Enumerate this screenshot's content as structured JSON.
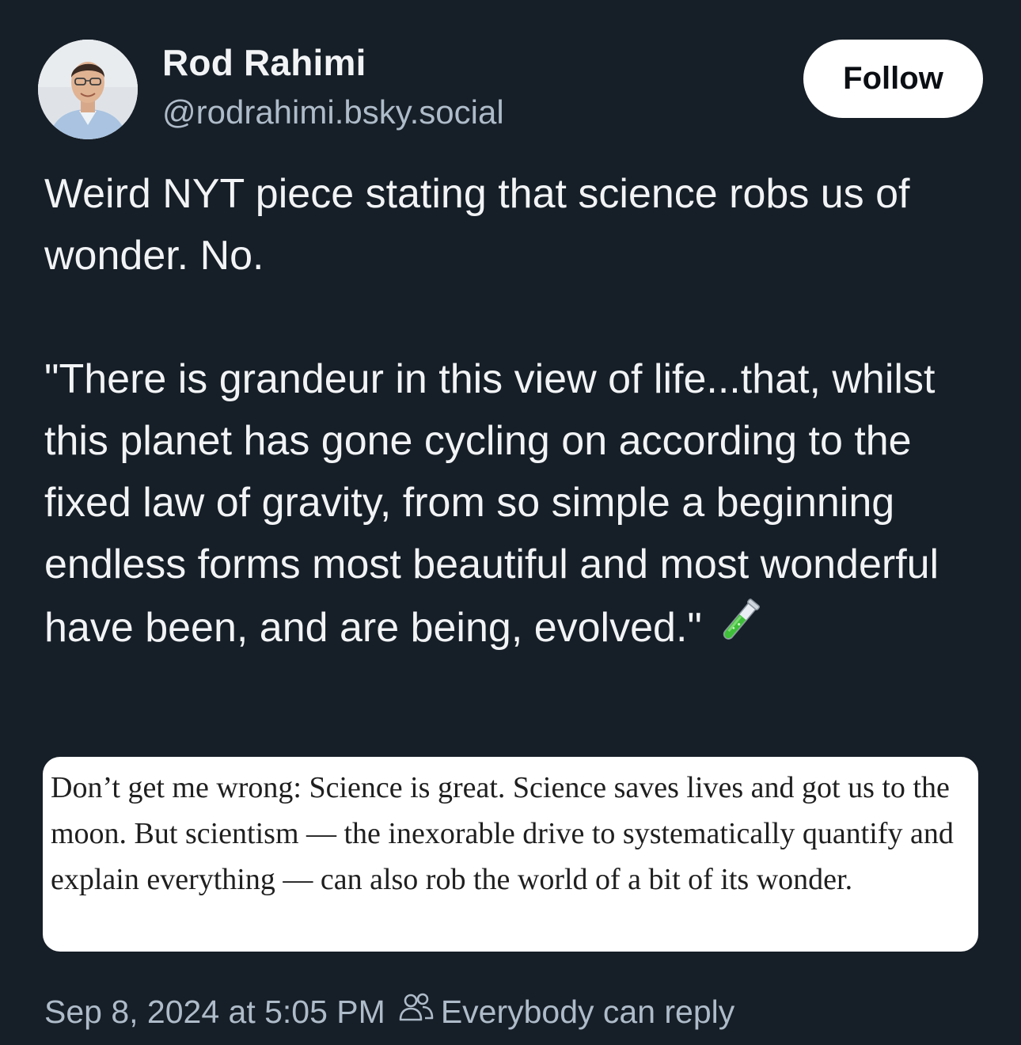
{
  "author": {
    "display_name": "Rod Rahimi",
    "handle": "@rodrahimi.bsky.social",
    "avatar_icon": "user-photo"
  },
  "follow_label": "Follow",
  "post": {
    "line_1": "Weird NYT piece stating that science robs us of wonder. No.",
    "quote": "\"There is grandeur in this view of life...that, whilst this planet has gone cycling on according to the fixed law of gravity, from so simple a beginning endless forms most beautiful and most wonderful have been, and are being, evolved.\"",
    "emoji_icon": "test-tube-icon"
  },
  "embedded_quote": {
    "text": "Don’t get me wrong: Science is great. Science saves lives and got us to the moon. But scientism — the inexorable drive to systematically quantify and explain everything — can also rob the world of a bit of its wonder."
  },
  "meta": {
    "timestamp": "Sep 8, 2024 at 5:05 PM",
    "reply_setting": "Everybody can reply",
    "reply_icon": "people-icon"
  },
  "colors": {
    "background": "#161e27",
    "text_primary": "#f1f3f5",
    "text_secondary": "#aebbc9",
    "follow_bg": "#ffffff",
    "accent_green": "#3fbf3a"
  }
}
